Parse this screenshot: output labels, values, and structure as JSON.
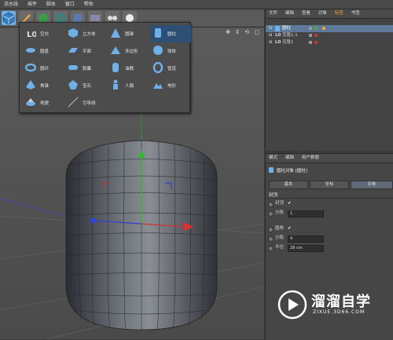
{
  "menubar": [
    "流水线",
    "插件",
    "脚本",
    "窗口",
    "帮助"
  ],
  "object_manager": {
    "menu": [
      "文件",
      "编辑",
      "查看",
      "对象",
      "标签",
      "书签"
    ],
    "active_menu": "标签",
    "tree": [
      {
        "label": "圆柱",
        "selected": true
      },
      {
        "label": "克隆1.1",
        "selected": false
      },
      {
        "label": "克隆1",
        "selected": false
      }
    ]
  },
  "attribute_manager": {
    "menu": [
      "模式",
      "编辑",
      "用户数据"
    ],
    "object_title": "圆柱对象 [圆柱]",
    "tabs": [
      "基本",
      "坐标",
      "对象"
    ],
    "section": "封顶",
    "rows": [
      {
        "label": "封顶",
        "value": "✔"
      },
      {
        "label": "分段",
        "value": "1"
      },
      {
        "label": "圆角",
        "value": "✔"
      },
      {
        "label": "分段",
        "value": "4"
      },
      {
        "label": "半径",
        "value": "28 cm"
      }
    ]
  },
  "dropdown": {
    "items": [
      {
        "label": "空白",
        "icon": "null-icon"
      },
      {
        "label": "立方体",
        "icon": "cube-icon"
      },
      {
        "label": "圆锥",
        "icon": "cone-icon"
      },
      {
        "label": "圆柱",
        "icon": "cylinder-icon"
      },
      {
        "label": "圆盘",
        "icon": "disc-icon"
      },
      {
        "label": "平面",
        "icon": "plane-icon"
      },
      {
        "label": "多边形",
        "icon": "polygon-icon"
      },
      {
        "label": "球体",
        "icon": "sphere-icon"
      },
      {
        "label": "圆环",
        "icon": "torus-icon"
      },
      {
        "label": "胶囊",
        "icon": "capsule-icon"
      },
      {
        "label": "油桶",
        "icon": "oil-tank-icon"
      },
      {
        "label": "管道",
        "icon": "tube-icon"
      },
      {
        "label": "角锥",
        "icon": "pyramid-icon"
      },
      {
        "label": "宝石",
        "icon": "platonic-icon"
      },
      {
        "label": "人偶",
        "icon": "figure-icon"
      },
      {
        "label": "地形",
        "icon": "landscape-icon"
      },
      {
        "label": "地貌",
        "icon": "relief-icon"
      },
      {
        "label": "引导线",
        "icon": "guide-icon"
      }
    ],
    "highlighted": "圆柱"
  },
  "watermark": {
    "title": "溜溜自学",
    "subtitle": "ZIXUE.3D66.COM"
  },
  "colors": {
    "accent": "#f0a030",
    "selection": "#5e7a9a",
    "highlight": "#2e4f75",
    "icon_blue": "#6fb0e8"
  }
}
